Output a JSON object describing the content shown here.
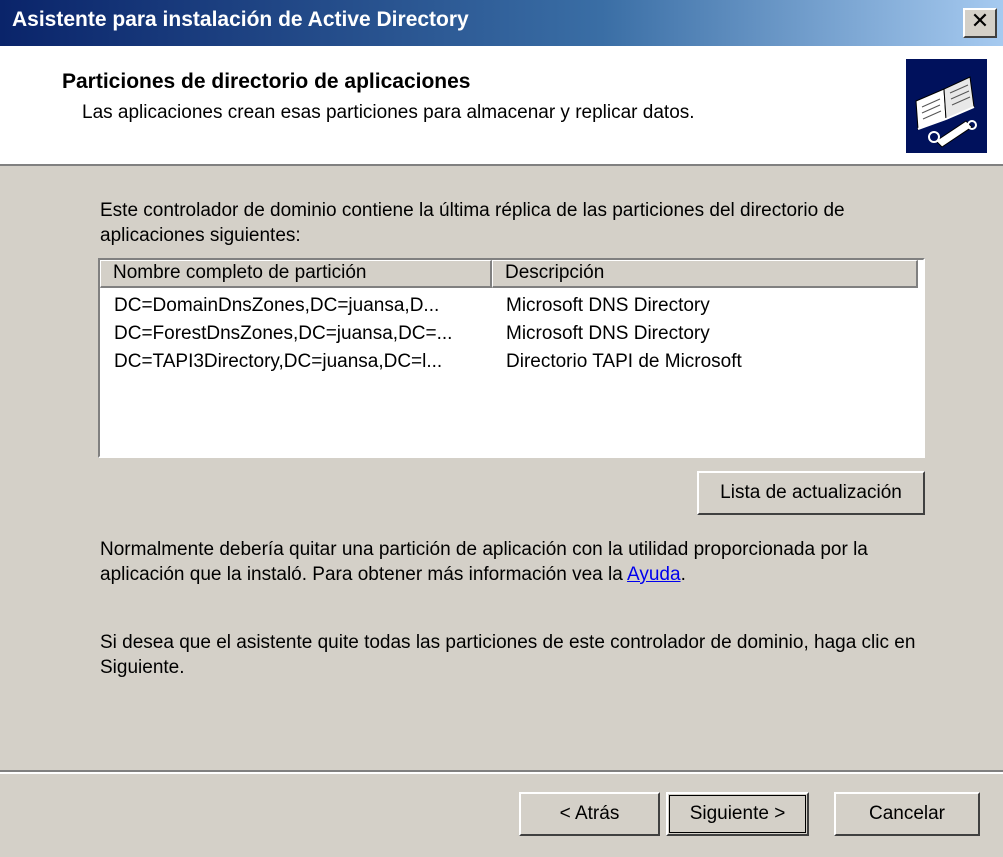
{
  "window": {
    "title": "Asistente para instalación de Active Directory",
    "close_glyph": "✕"
  },
  "header": {
    "title": "Particiones de directorio de aplicaciones",
    "subtitle": "Las aplicaciones crean esas particiones para almacenar y replicar datos.",
    "icon": "directory-book-icon"
  },
  "body": {
    "intro": "Este controlador de dominio contiene la última réplica de las particiones del directorio de aplicaciones siguientes:",
    "columns": [
      "Nombre completo de partición",
      "Descripción"
    ],
    "rows": [
      {
        "name": "DC=DomainDnsZones,DC=juansa,D...",
        "description": "Microsoft DNS Directory"
      },
      {
        "name": "DC=ForestDnsZones,DC=juansa,DC=...",
        "description": "Microsoft DNS Directory"
      },
      {
        "name": "DC=TAPI3Directory,DC=juansa,DC=l...",
        "description": "Directorio TAPI de Microsoft"
      }
    ],
    "refresh_button": "Lista de actualización",
    "note_before_link": "Normalmente debería quitar una partición de aplicación con la utilidad proporcionada por la aplicación que la instaló. Para obtener más información vea la ",
    "help_link": "Ayuda",
    "note_after_link": ".",
    "instruction": "Si desea que el asistente quite todas las particiones de este controlador de dominio, haga clic en Siguiente."
  },
  "footer": {
    "back_button": "< Atrás",
    "next_button": "Siguiente >",
    "cancel_button": "Cancelar"
  }
}
